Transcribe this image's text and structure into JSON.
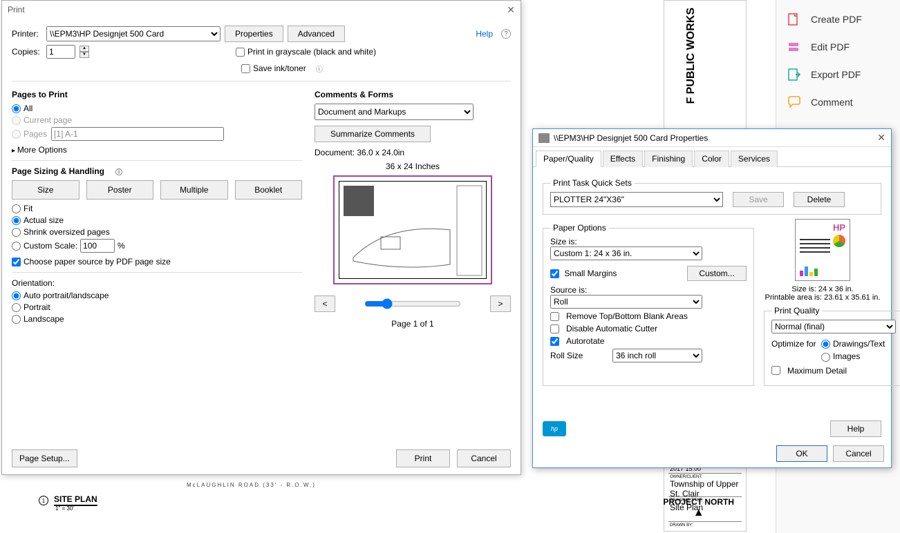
{
  "right_tools": {
    "create_pdf": "Create PDF",
    "edit_pdf": "Edit PDF",
    "export_pdf": "Export PDF",
    "comment": "Comment"
  },
  "bg_doc": {
    "vertical_text": "F PUBLIC WORKS",
    "year": "2017 15:00",
    "owner_lbl": "OWNER/CLIENT:",
    "owner": "Township of Upper St. Clair",
    "drawing_title_lbl": "DRAWING TITLE:",
    "drawing_title": "Site Plan",
    "drawn_lbl": "DRAWN BY:"
  },
  "bottom": {
    "road": "McLAUGHLIN  ROAD (33' - R.O.W.)",
    "site_plan": "SITE PLAN",
    "num": "1",
    "scale": "1\" = 30'",
    "project_north": "PROJECT NORTH"
  },
  "print": {
    "title": "Print",
    "printer_lbl": "Printer:",
    "printer_value": "\\\\EPM3\\HP Designjet 500 Card",
    "properties": "Properties",
    "advanced": "Advanced",
    "help": "Help",
    "copies_lbl": "Copies:",
    "copies_value": "1",
    "grayscale": "Print in grayscale (black and white)",
    "save_ink": "Save ink/toner",
    "pages_to_print": "Pages to Print",
    "all": "All",
    "current_page": "Current page",
    "pages_lbl": "Pages",
    "pages_value": "[1] A-1",
    "more_options": "More Options",
    "page_sizing": "Page Sizing & Handling",
    "size": "Size",
    "poster": "Poster",
    "multiple": "Multiple",
    "booklet": "Booklet",
    "fit": "Fit",
    "actual_size": "Actual size",
    "shrink": "Shrink oversized pages",
    "custom_scale": "Custom Scale:",
    "custom_scale_value": "100",
    "choose_paper": "Choose paper source by PDF page size",
    "orientation": "Orientation:",
    "auto_orient": "Auto portrait/landscape",
    "portrait": "Portrait",
    "landscape": "Landscape",
    "comments_forms": "Comments & Forms",
    "cf_value": "Document and Markups",
    "summarize": "Summarize Comments",
    "doc_dims": "Document: 36.0 x 24.0in",
    "preview_caption": "36 x 24 Inches",
    "prev": "<",
    "next": ">",
    "page_of": "Page 1 of 1",
    "page_setup": "Page Setup...",
    "print_btn": "Print",
    "cancel": "Cancel"
  },
  "props": {
    "title": "\\\\EPM3\\HP Designjet 500 Card Properties",
    "tabs": {
      "paper_quality": "Paper/Quality",
      "effects": "Effects",
      "finishing": "Finishing",
      "color": "Color",
      "services": "Services"
    },
    "quick_sets": "Print Task Quick Sets",
    "quick_sets_value": "PLOTTER 24\"X36\"",
    "save": "Save",
    "delete": "Delete",
    "paper_options": "Paper Options",
    "size_is": "Size is:",
    "size_value": "Custom 1:   24  x  36 in.",
    "small_margins": "Small Margins",
    "custom_btn": "Custom...",
    "source_is": "Source is:",
    "source_value": "Roll",
    "remove_blank": "Remove Top/Bottom Blank Areas",
    "disable_cutter": "Disable Automatic Cutter",
    "autorotate": "Autorotate",
    "roll_size": "Roll Size",
    "roll_size_value": "36 inch roll",
    "info_size": "Size is:   24  x  36 in.",
    "info_printable": "Printable area is:   23.61  x  35.61 in.",
    "print_quality": "Print Quality",
    "pq_value": "Normal (final)",
    "optimize_for": "Optimize for",
    "drawings_text": "Drawings/Text",
    "images": "Images",
    "max_detail": "Maximum Detail",
    "help": "Help",
    "ok": "OK",
    "cancel": "Cancel",
    "hp": "HP"
  }
}
